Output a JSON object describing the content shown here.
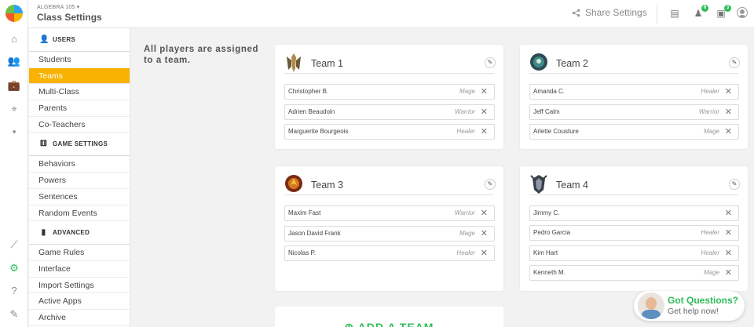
{
  "header": {
    "class_name": "ALGEBRA 105 ▾",
    "title": "Class Settings",
    "share_label": "Share Settings",
    "badges": {
      "students": "6",
      "messages": "3"
    }
  },
  "rail": {
    "icons": [
      "home-icon",
      "people-icon",
      "briefcase-icon",
      "map-pin-icon",
      "chat-icon",
      "chart-icon",
      "gear-icon",
      "help-icon",
      "pin-icon"
    ]
  },
  "sidebar": {
    "sections": [
      {
        "title": "USERS",
        "icon": "user-icon",
        "items": [
          "Students",
          "Teams",
          "Multi-Class",
          "Parents",
          "Co-Teachers"
        ]
      },
      {
        "title": "GAME SETTINGS",
        "icon": "dice-icon",
        "items": [
          "Behaviors",
          "Powers",
          "Sentences",
          "Random Events"
        ]
      },
      {
        "title": "ADVANCED",
        "icon": "bar-chart-icon",
        "items": [
          "Game Rules",
          "Interface",
          "Import Settings",
          "Active Apps",
          "Archive"
        ]
      }
    ],
    "active_item": "Teams"
  },
  "main": {
    "notice": "All players are assigned to a team.",
    "teams": [
      {
        "name": "Team 1",
        "players": [
          {
            "name": "Christopher B.",
            "role": "Mage"
          },
          {
            "name": "Adrien Beaudoin",
            "role": "Warrior"
          },
          {
            "name": "Marguerite Bourgeois",
            "role": "Healer"
          }
        ]
      },
      {
        "name": "Team 2",
        "players": [
          {
            "name": "Amanda C.",
            "role": "Healer"
          },
          {
            "name": "Jeff Calm",
            "role": "Warrior"
          },
          {
            "name": "Arlette Cousture",
            "role": "Mage"
          }
        ]
      },
      {
        "name": "Team 3",
        "players": [
          {
            "name": "Maxim Fast",
            "role": "Warrior"
          },
          {
            "name": "Jason David Frank",
            "role": "Mage"
          },
          {
            "name": "Nicolas P.",
            "role": "Healer"
          }
        ]
      },
      {
        "name": "Team 4",
        "players": [
          {
            "name": "Jimmy C.",
            "role": ""
          },
          {
            "name": "Pedro Garcia",
            "role": "Healer"
          },
          {
            "name": "Kim Hart",
            "role": "Healer"
          },
          {
            "name": "Kenneth M.",
            "role": "Mage"
          }
        ]
      }
    ],
    "add_team_label": "⊕ ADD A TEAM"
  },
  "help": {
    "title": "Got Questions?",
    "subtitle": "Get help now!"
  },
  "colors": {
    "accent": "#f8b200",
    "green": "#2ebd59"
  }
}
